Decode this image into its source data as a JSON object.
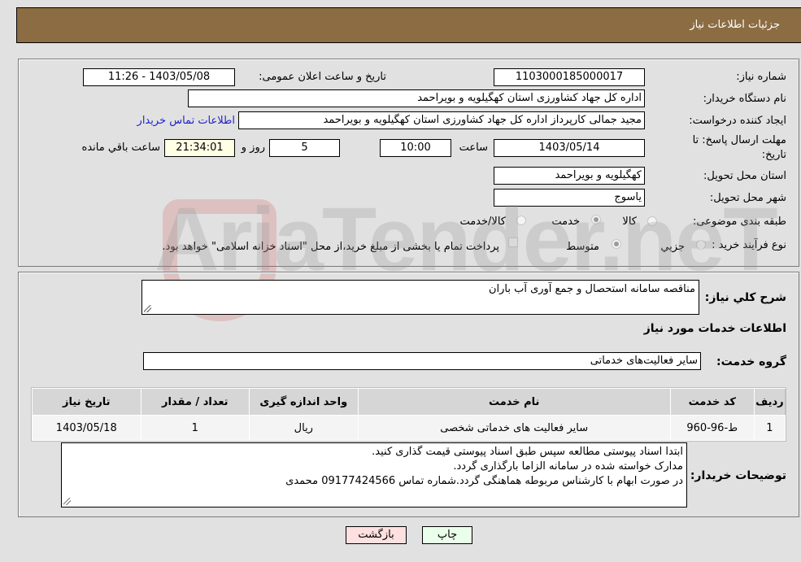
{
  "header": {
    "title": "جزئیات اطلاعات نیاز"
  },
  "info": {
    "need_number": {
      "label": "شماره نیاز:",
      "value": "1103000185000017"
    },
    "announce": {
      "label": "تاریخ و ساعت اعلان عمومی:",
      "value": "1403/05/08 - 11:26"
    },
    "buyer_org": {
      "label": "نام دستگاه خریدار:",
      "value": "اداره کل جهاد کشاورزی استان کهگیلویه و بویراحمد"
    },
    "creator": {
      "label": "ایجاد کننده درخواست:",
      "value": "مجید جمالی کارپرداز اداره کل جهاد کشاورزی استان کهگیلویه و بویراحمد"
    },
    "contact_link": "اطلاعات تماس خریدار",
    "deadline": {
      "label_line1": "مهلت ارسال پاسخ: تا",
      "label_line2": "تاریخ:",
      "date": "1403/05/14",
      "time_label": "ساعت",
      "time": "10:00",
      "days": "5",
      "days_label": "روز و",
      "remaining": "21:34:01",
      "remaining_label": "ساعت باقي مانده"
    },
    "province": {
      "label": "استان محل تحویل:",
      "value": "کهگیلویه و بویراحمد"
    },
    "city": {
      "label": "شهر محل تحویل:",
      "value": "یاسوج"
    },
    "category": {
      "label": "طبقه بندی موضوعی:",
      "options": [
        "کالا",
        "خدمت",
        "کالا/خدمت"
      ],
      "selected": "خدمت"
    },
    "process": {
      "label": "نوع فرآیند خرید :",
      "options": [
        "جزيي",
        "متوسط"
      ],
      "selected": "متوسط",
      "payment_note": "پرداخت تمام یا بخشی از مبلغ خرید،از محل \"اسناد خزانه اسلامی\" خواهد بود.",
      "payment_checked": false
    }
  },
  "details": {
    "summary_label": "شرح كلي نياز:",
    "summary": "مناقصه سامانه استحصال و جمع آوری آب باران",
    "services_heading": "اطلاعات خدمات مورد نیاز",
    "group_label": "گروه خدمت:",
    "group_value": "سایر فعالیت‌های خدماتی",
    "table": {
      "headers": [
        "ردیف",
        "کد خدمت",
        "نام خدمت",
        "واحد اندازه گیری",
        "تعداد / مقدار",
        "تاریخ نیاز"
      ],
      "rows": [
        [
          "1",
          "ط-96-960",
          "سایر فعالیت های خدماتی شخصی",
          "ریال",
          "1",
          "1403/05/18"
        ]
      ]
    },
    "buyer_notes_label": "توضیحات خریدار:",
    "buyer_notes": [
      "ابتدا اسناد پیوستی مطالعه سپس طبق اسناد پیوستی قیمت گذاری کنید.",
      "مدارک خواسته شده در سامانه الزاما بارگذاری گردد.",
      "در صورت ابهام با کارشناس مربوطه هماهنگی گردد.شماره تماس 09177424566 محمدی"
    ]
  },
  "buttons": {
    "print": "چاپ",
    "back": "بازگشت"
  },
  "watermark": "AriaTender.neT",
  "colors": {
    "header": "#8c6d43",
    "print_bg": "#eaffea",
    "back_bg": "#ffe0e0",
    "remaining_bg": "#ffffe6",
    "link": "#2222cc"
  }
}
